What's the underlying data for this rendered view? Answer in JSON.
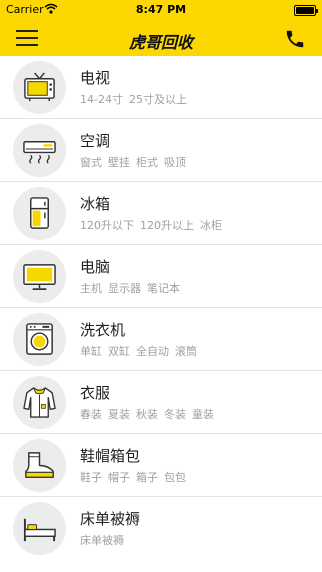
{
  "status_bar": {
    "carrier": "Carrier",
    "time": "8:47 PM"
  },
  "nav": {
    "title": "虎哥回收",
    "left_icon": "menu-icon",
    "right_icon": "phone-icon"
  },
  "colors": {
    "brand_yellow": "#fcd800",
    "icon_yellow": "#f5d800",
    "circle_bg": "#ececec",
    "tag_gray": "#a0a0a0"
  },
  "categories": [
    {
      "title": "电视",
      "icon": "tv-icon",
      "tags": [
        "14-24寸",
        "25寸及以上"
      ]
    },
    {
      "title": "空调",
      "icon": "air-conditioner-icon",
      "tags": [
        "窗式",
        "壁挂",
        "柜式",
        "吸顶"
      ]
    },
    {
      "title": "冰箱",
      "icon": "fridge-icon",
      "tags": [
        "120升以下",
        "120升以上",
        "冰柜"
      ]
    },
    {
      "title": "电脑",
      "icon": "monitor-icon",
      "tags": [
        "主机",
        "显示器",
        "笔记本"
      ]
    },
    {
      "title": "洗衣机",
      "icon": "washing-machine-icon",
      "tags": [
        "单缸",
        "双缸",
        "全自动",
        "滚筒"
      ]
    },
    {
      "title": "衣服",
      "icon": "clothes-icon",
      "tags": [
        "春装",
        "夏装",
        "秋装",
        "冬装",
        "童装"
      ]
    },
    {
      "title": "鞋帽箱包",
      "icon": "shoe-icon",
      "tags": [
        "鞋子",
        "帽子",
        "箱子",
        "包包"
      ]
    },
    {
      "title": "床单被褥",
      "icon": "bed-icon",
      "tags": [
        "床单被褥"
      ]
    }
  ]
}
